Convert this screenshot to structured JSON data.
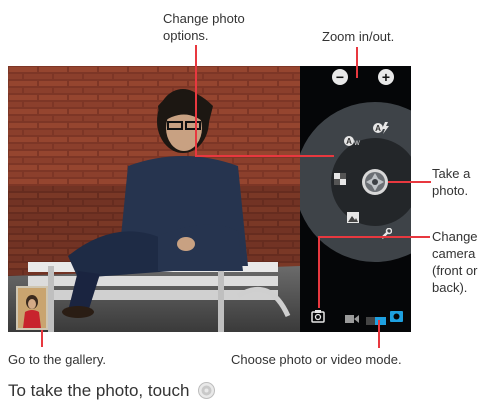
{
  "callouts": {
    "photo_options": [
      "Change photo",
      "options."
    ],
    "zoom": "Zoom in/out.",
    "take_photo": [
      "Take a",
      "photo."
    ],
    "change_camera": [
      "Change",
      "camera",
      "(front or",
      "back)."
    ],
    "gallery": "Go to the gallery.",
    "mode": "Choose photo or video mode."
  },
  "instruction": "To take the photo, touch",
  "controls": {
    "zoom_out_icon": "minus-icon",
    "zoom_in_icon": "plus-icon",
    "zoom_out_symbol": "−",
    "zoom_in_symbol": "+"
  },
  "colors": {
    "callout_line": "#e8383f",
    "accent": "#1ea0e0"
  }
}
